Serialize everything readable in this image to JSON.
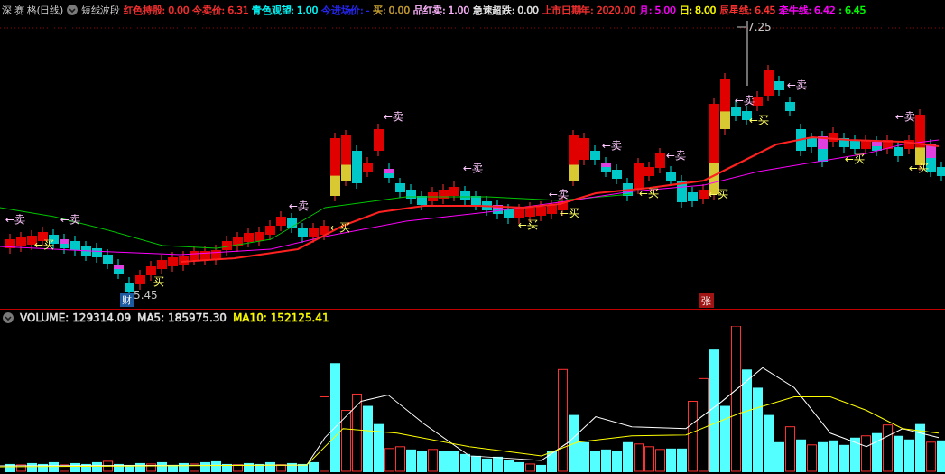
{
  "header": {
    "title": "深 赛 格(日线)",
    "indicator": "短线波段",
    "fields": [
      {
        "label": "红色持股:",
        "value": "0.00",
        "color": "#ff3232"
      },
      {
        "label": "今卖价:",
        "value": "6.31",
        "color": "#ff3232"
      },
      {
        "label": "青色观望:",
        "value": "1.00",
        "color": "#00ffff"
      },
      {
        "label": "今进场价:",
        "value": "-",
        "color": "#2828ff"
      },
      {
        "label": "买:",
        "value": "0.00",
        "color": "#c8a032"
      },
      {
        "label": "品红卖:",
        "value": "1.00",
        "color": "#ffb4ff"
      },
      {
        "label": "急速超跌:",
        "value": "0.00",
        "color": "#e6e6e6"
      },
      {
        "label": "上市日期年:",
        "value": "2020.00",
        "color": "#ff3232"
      },
      {
        "label": "月:",
        "value": "5.00",
        "color": "#ff00ff"
      },
      {
        "label": "日:",
        "value": "8.00",
        "color": "#ffff00"
      },
      {
        "label": "辰星线:",
        "value": "6.45",
        "color": "#ff3232"
      },
      {
        "label": "牵牛线:",
        "value": "6.42",
        "color": "#ff00ff"
      },
      {
        "label": ":",
        "value": "6.45",
        "color": "#00ff00"
      }
    ]
  },
  "price_chart": {
    "markers": [
      {
        "kind": "sell",
        "text": "←卖"
      },
      {
        "kind": "sell",
        "text": "←卖"
      },
      {
        "kind": "sell",
        "text": "←卖"
      },
      {
        "kind": "sell",
        "text": "←卖"
      },
      {
        "kind": "sell",
        "text": "←卖"
      },
      {
        "kind": "sell",
        "text": "←卖"
      },
      {
        "kind": "sell",
        "text": "←卖"
      },
      {
        "kind": "sell",
        "text": "←卖"
      },
      {
        "kind": "sell",
        "text": "←卖"
      },
      {
        "kind": "sell",
        "text": "←卖"
      },
      {
        "kind": "sell",
        "text": "←卖"
      },
      {
        "kind": "buy",
        "text": "←买"
      },
      {
        "kind": "buy",
        "text": "←买"
      },
      {
        "kind": "buy",
        "text": "←买"
      },
      {
        "kind": "buy",
        "text": "←买"
      },
      {
        "kind": "buy",
        "text": "←买"
      },
      {
        "kind": "buy",
        "text": "←买"
      },
      {
        "kind": "buy",
        "text": "←买"
      },
      {
        "kind": "buy",
        "text": "←买"
      },
      {
        "kind": "buy",
        "text": "←买"
      },
      {
        "kind": "buy",
        "text": "买"
      },
      {
        "kind": "price",
        "text": "7.25"
      },
      {
        "kind": "price",
        "text": "5.45"
      },
      {
        "kind": "badge",
        "text": "财",
        "color": "#1e5aa0"
      },
      {
        "kind": "badge",
        "text": "张",
        "color": "#a01414"
      }
    ]
  },
  "volume_header": {
    "fields": [
      {
        "label": "VOLUME:",
        "value": "129314.09",
        "color": "#e6e6e6"
      },
      {
        "label": "MA5:",
        "value": "185975.30",
        "color": "#e6e6e6"
      },
      {
        "label": "MA10:",
        "value": "152125.41",
        "color": "#ffff00"
      }
    ]
  }
}
